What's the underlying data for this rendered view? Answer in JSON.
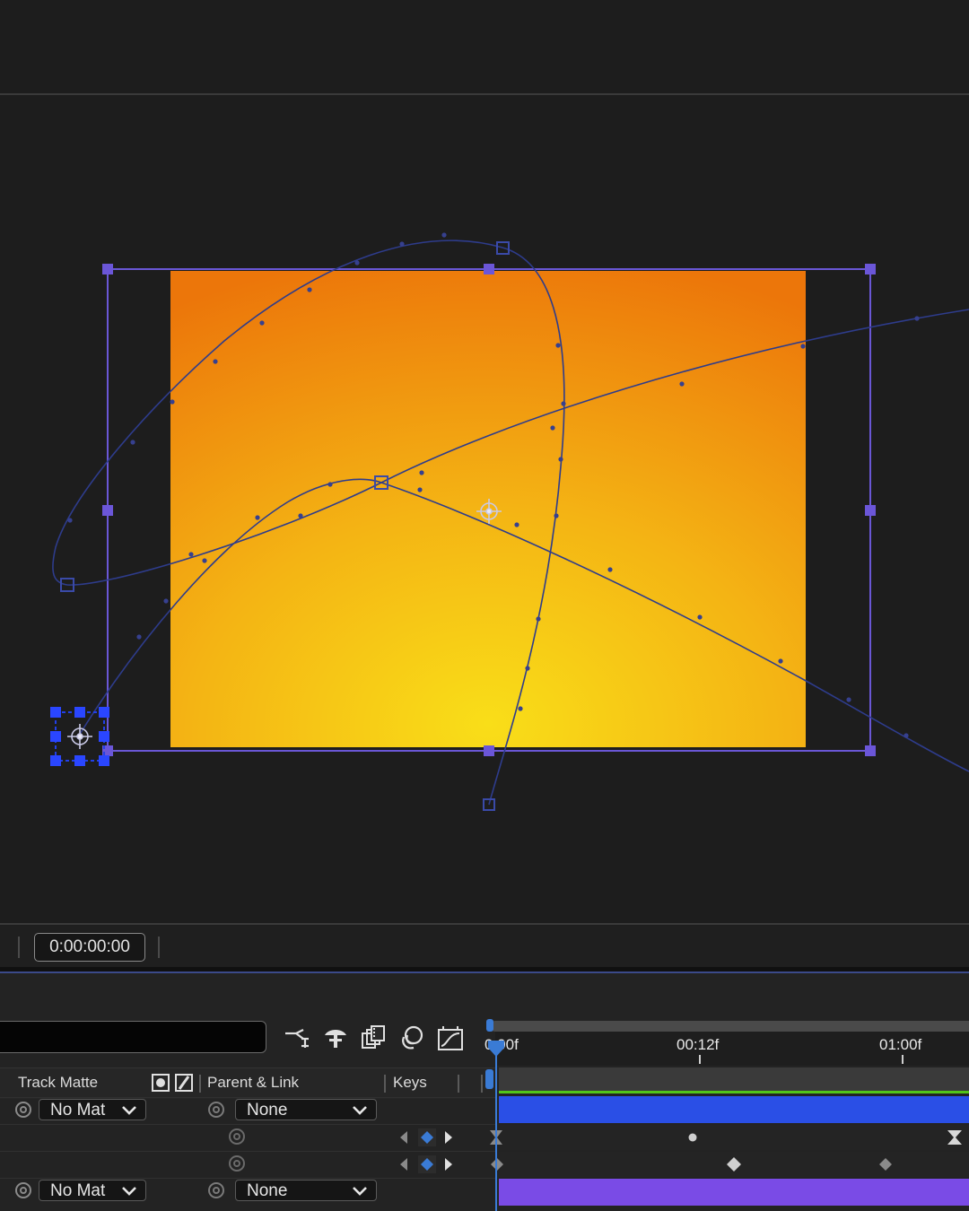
{
  "timecode": "0:00:00:00",
  "ruler": {
    "labels": [
      "0:00f",
      "00:12f",
      "01:00f"
    ]
  },
  "columns": {
    "track_matte": "Track Matte",
    "parent_link": "Parent & Link",
    "keys": "Keys"
  },
  "layers": [
    {
      "track_matte": "No Mat",
      "parent": "None",
      "bar_color": "#2a4fe6"
    },
    {
      "track_matte": "No Mat",
      "parent": "None",
      "bar_color": "#7a4be6"
    }
  ],
  "colors": {
    "comp_gradient_center": "#f8dc1a",
    "comp_gradient_edge": "#ee7d0c",
    "handle": "#6b56d8",
    "playhead": "#3a7bd5"
  },
  "icons": {
    "timeline_tools": [
      "flowchart-icon",
      "solo-shy-icon",
      "frame-blend-icon",
      "motion-blur-icon",
      "graph-editor-icon"
    ]
  }
}
